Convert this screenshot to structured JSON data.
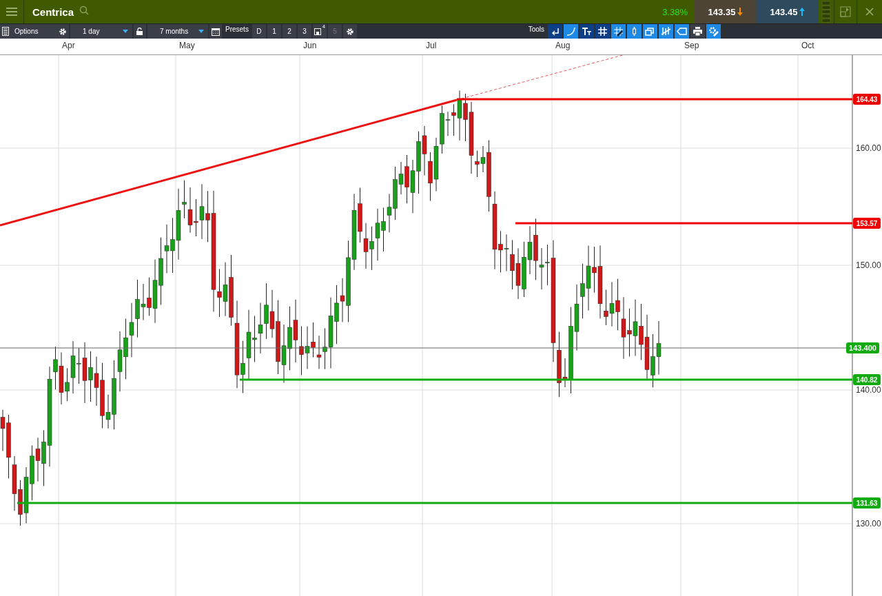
{
  "header": {
    "instrument": "Centrica",
    "change": "3.38%",
    "sell": "143.35",
    "buy": "143.45"
  },
  "toolbar": {
    "options": "Options",
    "interval": "1 day",
    "range": "7 months",
    "presets_label": "Presets",
    "presets": [
      {
        "label": "D",
        "disabled": false
      },
      {
        "label": "1",
        "disabled": false
      },
      {
        "label": "2",
        "disabled": false
      },
      {
        "label": "3",
        "disabled": false
      },
      {
        "label": "5",
        "disabled": true
      }
    ],
    "save_badge": "4",
    "tools_label": "Tools",
    "tools": [
      {
        "selected": true
      },
      {
        "selected": false
      },
      {
        "selected": true
      },
      {
        "selected": true
      },
      {
        "selected": false
      },
      {
        "selected": false
      },
      {
        "selected": false
      },
      {
        "selected": false
      },
      {
        "selected": false
      },
      {
        "selected": false
      },
      {
        "selected": false
      }
    ]
  },
  "chart": {
    "months": [
      "Apr",
      "May",
      "Jun",
      "Jul",
      "Aug",
      "Sep",
      "Oct"
    ],
    "y_ticks": [
      "160.00",
      "150.00",
      "140.00",
      "130.00"
    ],
    "levels": [
      {
        "label": "164.43",
        "color": "#ee0000"
      },
      {
        "label": "153.57",
        "color": "#ee0000"
      },
      {
        "label": "143.400",
        "color": "#11aa11"
      },
      {
        "label": "140.82",
        "color": "#11aa11"
      },
      {
        "label": "131.63",
        "color": "#11aa11"
      }
    ]
  }
}
